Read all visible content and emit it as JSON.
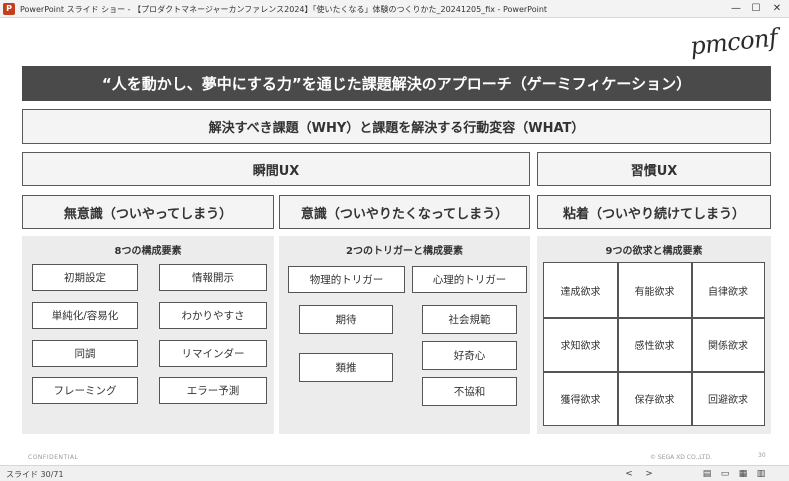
{
  "window": {
    "app_icon": "P",
    "title": "PowerPoint スライド ショー - 【プロダクトマネージャーカンファレンス2024】「使いたくなる」体験のつくりかた_20241205_fix - PowerPoint",
    "minimize": "—",
    "maximize": "☐",
    "close": "✕"
  },
  "slide": {
    "logo": "pmconf",
    "banner": "“人を動かし、夢中にする力”を通じた課題解決のアプローチ（ゲーミフィケーション）",
    "problem_box": "解決すべき課題（WHY）と課題を解決する行動変容（WHAT）",
    "instant_ux": "瞬間UX",
    "habit_ux": "習慣UX",
    "unconscious": "無意識（ついやってしまう）",
    "conscious": "意識（ついやりたくなってしまう）",
    "sticky": "粘着（ついやり続けてしまう）",
    "panel1": {
      "title": "8つの構成要素",
      "items": [
        "初期設定",
        "情報開示",
        "単純化/容易化",
        "わかりやすさ",
        "同調",
        "リマインダー",
        "フレーミング",
        "エラー予測"
      ]
    },
    "panel2": {
      "title": "2つのトリガーと構成要素",
      "physical": "物理的トリガー",
      "psychological": "心理的トリガー",
      "physical_items": [
        "期待",
        "類推"
      ],
      "psychological_items": [
        "社会規範",
        "好奇心",
        "不協和"
      ]
    },
    "panel3": {
      "title": "9つの欲求と構成要素",
      "cells": [
        "達成欲求",
        "有能欲求",
        "自律欲求",
        "求知欲求",
        "感性欲求",
        "関係欲求",
        "獲得欲求",
        "保存欲求",
        "回避欲求"
      ]
    },
    "footer_left": "CONFIDENTIAL",
    "footer_right": "© SEGA XD CO.,LTD.",
    "page_number": "30"
  },
  "statusbar": {
    "slide_counter": "スライド 30/71",
    "prev_icon": "<",
    "next_icon": ">",
    "icons": [
      "▤",
      "▭",
      "▦",
      "▥"
    ]
  }
}
